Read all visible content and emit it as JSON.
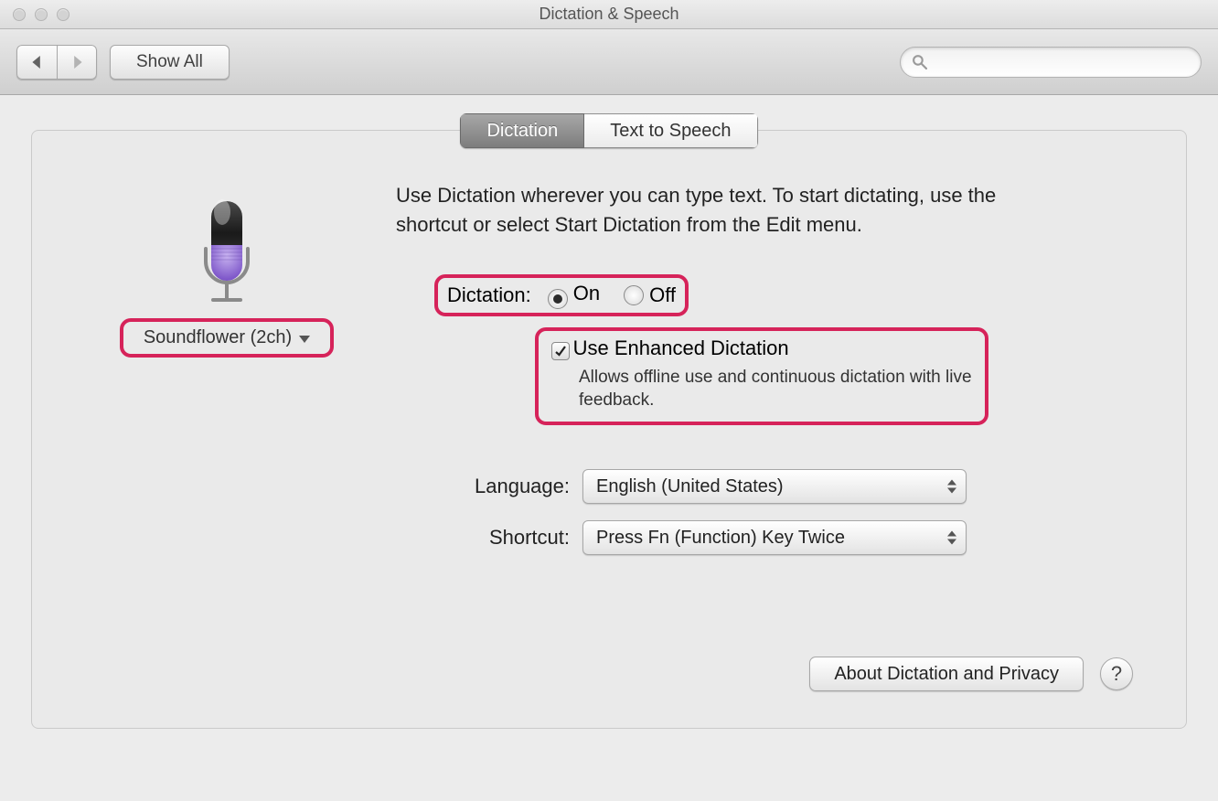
{
  "window": {
    "title": "Dictation & Speech"
  },
  "toolbar": {
    "showAll": "Show All",
    "search": {
      "placeholder": ""
    }
  },
  "tabs": {
    "dictation": "Dictation",
    "tts": "Text to Speech"
  },
  "intro": "Use Dictation wherever you can type text. To start dictating, use the shortcut or select Start Dictation from the Edit menu.",
  "audioDevice": {
    "label": "Soundflower (2ch)"
  },
  "dictation": {
    "label": "Dictation:",
    "on": "On",
    "off": "Off",
    "selected": "on"
  },
  "enhanced": {
    "label": "Use Enhanced Dictation",
    "desc": "Allows offline use and continuous dictation with live feedback.",
    "checked": true
  },
  "language": {
    "label": "Language:",
    "value": "English (United States)"
  },
  "shortcut": {
    "label": "Shortcut:",
    "value": "Press Fn (Function) Key Twice"
  },
  "footer": {
    "about": "About Dictation and Privacy",
    "help": "?"
  }
}
